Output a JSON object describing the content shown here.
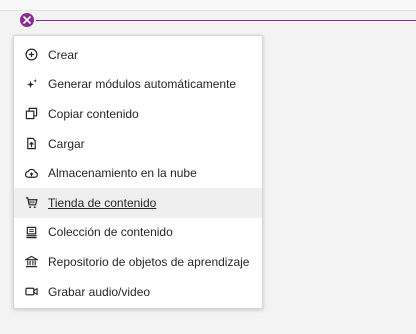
{
  "colors": {
    "accent": "#8a2a8f",
    "menu_text": "#262626",
    "hover_bg": "#efefef"
  },
  "add_toggle": {
    "icon": "close-icon"
  },
  "menu": {
    "items": [
      {
        "label": "Crear",
        "icon": "plus-circle-icon"
      },
      {
        "label": "Generar módulos automáticamente",
        "icon": "sparkle-icon"
      },
      {
        "label": "Copiar contenido",
        "icon": "copy-icon"
      },
      {
        "label": "Cargar",
        "icon": "upload-icon"
      },
      {
        "label": "Almacenamiento en la nube",
        "icon": "cloud-upload-icon"
      },
      {
        "label": "Tienda de contenido",
        "icon": "cart-icon",
        "highlighted": true
      },
      {
        "label": "Colección de contenido",
        "icon": "collection-icon"
      },
      {
        "label": "Repositorio de objetos de aprendizaje",
        "icon": "institution-icon"
      },
      {
        "label": "Grabar audio/video",
        "icon": "video-camera-icon"
      }
    ]
  }
}
